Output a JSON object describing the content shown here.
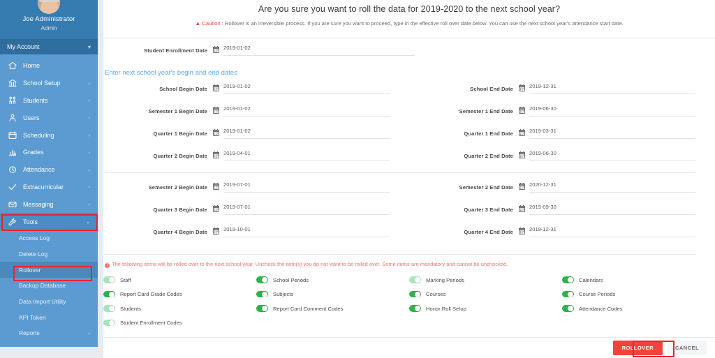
{
  "sidebar": {
    "profile": {
      "name": "Joe Administrator",
      "role": "Admin",
      "avatar_icon": "user-avatar"
    },
    "account": {
      "label": "My Account",
      "chevron_icon": "chevron-down-icon"
    },
    "items": [
      {
        "label": "Home",
        "icon": "home-icon",
        "arrow": ""
      },
      {
        "label": "School Setup",
        "icon": "bank-icon",
        "arrow": "›"
      },
      {
        "label": "Students",
        "icon": "students-icon",
        "arrow": "›"
      },
      {
        "label": "Users",
        "icon": "user-icon",
        "arrow": "›"
      },
      {
        "label": "Scheduling",
        "icon": "calendar-icon",
        "arrow": "›"
      },
      {
        "label": "Grades",
        "icon": "chart-icon",
        "arrow": "›"
      },
      {
        "label": "Attendance",
        "icon": "clock-icon",
        "arrow": "›"
      },
      {
        "label": "Extracurricular",
        "icon": "check-icon",
        "arrow": "›"
      },
      {
        "label": "Messaging",
        "icon": "envelope-icon",
        "arrow": "›"
      },
      {
        "label": "Tools",
        "icon": "tools-icon",
        "arrow": "⌄"
      }
    ],
    "submenu": [
      {
        "label": "Access Log",
        "arrow": ""
      },
      {
        "label": "Delete Log",
        "arrow": ""
      },
      {
        "label": "Rollover",
        "arrow": ""
      },
      {
        "label": "Backup Database",
        "arrow": ""
      },
      {
        "label": "Data Import Utility",
        "arrow": ""
      },
      {
        "label": "API Token",
        "arrow": ""
      },
      {
        "label": "Reports",
        "arrow": "›"
      }
    ],
    "selected_submenu": "Rollover",
    "active_item": "Tools"
  },
  "header": {
    "title": "Are you sure you want to roll the data for 2019-2020 to the next school year?",
    "caution_icon": "warning-triangle-icon",
    "caution_label": "Caution",
    "caution_separator": " : ",
    "caution_text": "Rollover is an irreversible process. If you are sure you want to proceed, type in the effective roll over date below. You can use the next school year's attendance start date."
  },
  "enrollment": {
    "label": "Student Enrollment Date",
    "value": "2019-01-02",
    "calendar_icon": "calendar-icon"
  },
  "section_label": "Enter next school year's begin and end dates",
  "dates": {
    "group1_left": [
      {
        "label": "School Begin Date",
        "value": "2019-01-02",
        "calendar_icon": "calendar-icon"
      },
      {
        "label": "Semester 1 Begin Date",
        "value": "2019-01-02",
        "calendar_icon": "calendar-icon"
      },
      {
        "label": "Quarter 1 Begin Date",
        "value": "2019-01-02",
        "calendar_icon": "calendar-icon"
      },
      {
        "label": "Quarter 2 Begin Date",
        "value": "2019-04-01",
        "calendar_icon": "calendar-icon"
      }
    ],
    "group1_right": [
      {
        "label": "School End Date",
        "value": "2019-12-31",
        "calendar_icon": "calendar-icon"
      },
      {
        "label": "Semester 1 End Date",
        "value": "2019-06-30",
        "calendar_icon": "calendar-icon"
      },
      {
        "label": "Quarter 1 End Date",
        "value": "2019-03-31",
        "calendar_icon": "calendar-icon"
      },
      {
        "label": "Quarter 2 End Date",
        "value": "2019-06-30",
        "calendar_icon": "calendar-icon"
      }
    ],
    "group2_left": [
      {
        "label": "Semester 2 Begin Date",
        "value": "2019-07-01",
        "calendar_icon": "calendar-icon"
      },
      {
        "label": "Quarter 3 Begin Date",
        "value": "2019-07-01",
        "calendar_icon": "calendar-icon"
      },
      {
        "label": "Quarter 4 Begin Date",
        "value": "2019-10-01",
        "calendar_icon": "calendar-icon"
      }
    ],
    "group2_right": [
      {
        "label": "Semester 2 End Date",
        "value": "2020-12-31",
        "calendar_icon": "calendar-icon"
      },
      {
        "label": "Quarter 3 End Date",
        "value": "2019-09-30",
        "calendar_icon": "calendar-icon"
      },
      {
        "label": "Quarter 4 End Date",
        "value": "2019-12-31",
        "calendar_icon": "calendar-icon"
      }
    ]
  },
  "rollover_items": {
    "warning_icon": "exclamation-circle-icon",
    "warning": "The following items will be rolled over to the next school year. Uncheck the item(s) you do not want to be rolled over. Some items are mandatory and cannot be unchecked.",
    "col1": [
      {
        "label": "Staff",
        "state": "on",
        "mandatory": true
      },
      {
        "label": "Report Card Grade Codes",
        "state": "on",
        "mandatory": false
      },
      {
        "label": "Students",
        "state": "on",
        "mandatory": true
      },
      {
        "label": "Student Enrollment Codes",
        "state": "on",
        "mandatory": true
      }
    ],
    "col2": [
      {
        "label": "School Periods",
        "state": "on",
        "mandatory": false
      },
      {
        "label": "Subjects",
        "state": "on",
        "mandatory": false
      },
      {
        "label": "Report Card Comment Codes",
        "state": "on",
        "mandatory": false
      }
    ],
    "col3": [
      {
        "label": "Marking Periods",
        "state": "on",
        "mandatory": true
      },
      {
        "label": "Courses",
        "state": "on",
        "mandatory": false
      },
      {
        "label": "Honor Roll Setup",
        "state": "on",
        "mandatory": false
      }
    ],
    "col4": [
      {
        "label": "Calendars",
        "state": "on",
        "mandatory": false
      },
      {
        "label": "Course Periods",
        "state": "on",
        "mandatory": false
      },
      {
        "label": "Attendance Codes",
        "state": "on",
        "mandatory": false
      }
    ]
  },
  "actions": {
    "rollover_label": "ROLLOVER",
    "cancel_label": "CANCEL"
  },
  "colors": {
    "sidebar": "#5b9bd1",
    "sidebar_dark": "#2f6d9e",
    "accent_blue": "#5caaea",
    "danger": "#f4423c",
    "toggle_on": "#2cb34a",
    "toggle_mandatory": "#a8e5b8",
    "annotation": "#e8262b"
  }
}
